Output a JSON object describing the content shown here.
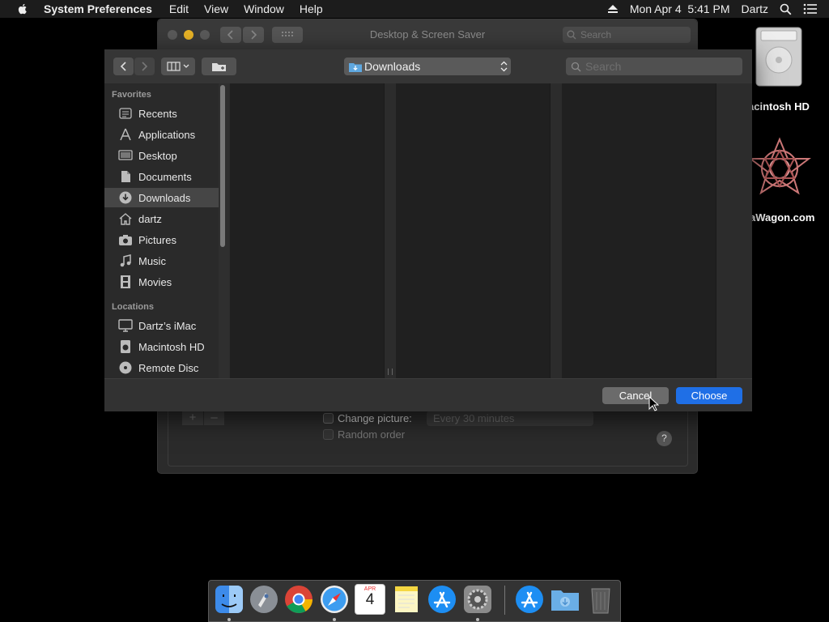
{
  "menubar": {
    "app_name": "System Preferences",
    "items": [
      "Edit",
      "View",
      "Window",
      "Help"
    ],
    "datetime": "Mon Apr 4  5:41 PM",
    "user": "Dartz"
  },
  "sysprefs": {
    "title": "Desktop & Screen Saver",
    "search_placeholder": "Search",
    "change_picture_label": "Change picture:",
    "interval_value": "Every 30 minutes",
    "random_order_label": "Random order",
    "help_label": "?"
  },
  "desktop": {
    "icons": [
      {
        "label": "acintosh HD"
      },
      {
        "label": "aWagon.com"
      }
    ]
  },
  "panel": {
    "path_popup": "Downloads",
    "search_placeholder": "Search",
    "sidebar": {
      "favorites_heading": "Favorites",
      "favorites": [
        {
          "label": "Recents",
          "icon": "recents-icon"
        },
        {
          "label": "Applications",
          "icon": "applications-icon"
        },
        {
          "label": "Desktop",
          "icon": "desktop-icon"
        },
        {
          "label": "Documents",
          "icon": "documents-icon"
        },
        {
          "label": "Downloads",
          "icon": "downloads-icon",
          "selected": true
        },
        {
          "label": "dartz",
          "icon": "home-icon"
        },
        {
          "label": "Pictures",
          "icon": "pictures-icon"
        },
        {
          "label": "Music",
          "icon": "music-icon"
        },
        {
          "label": "Movies",
          "icon": "movies-icon"
        }
      ],
      "locations_heading": "Locations",
      "locations": [
        {
          "label": "Dartz’s iMac",
          "icon": "imac-icon"
        },
        {
          "label": "Macintosh HD",
          "icon": "hard-disk-icon"
        },
        {
          "label": "Remote Disc",
          "icon": "remote-disc-icon"
        }
      ]
    },
    "cancel_label": "Cancel",
    "choose_label": "Choose"
  },
  "dock": {
    "apps": [
      "Finder",
      "Launchpad",
      "Chrome",
      "Safari",
      "Calendar",
      "Notes",
      "App Store",
      "System Preferences",
      "App Store Downloads",
      "Downloads Folder",
      "Trash"
    ],
    "calendar_month": "APR",
    "calendar_day": "4"
  },
  "colors": {
    "accent": "#1f6fe6",
    "background": "#000000"
  }
}
